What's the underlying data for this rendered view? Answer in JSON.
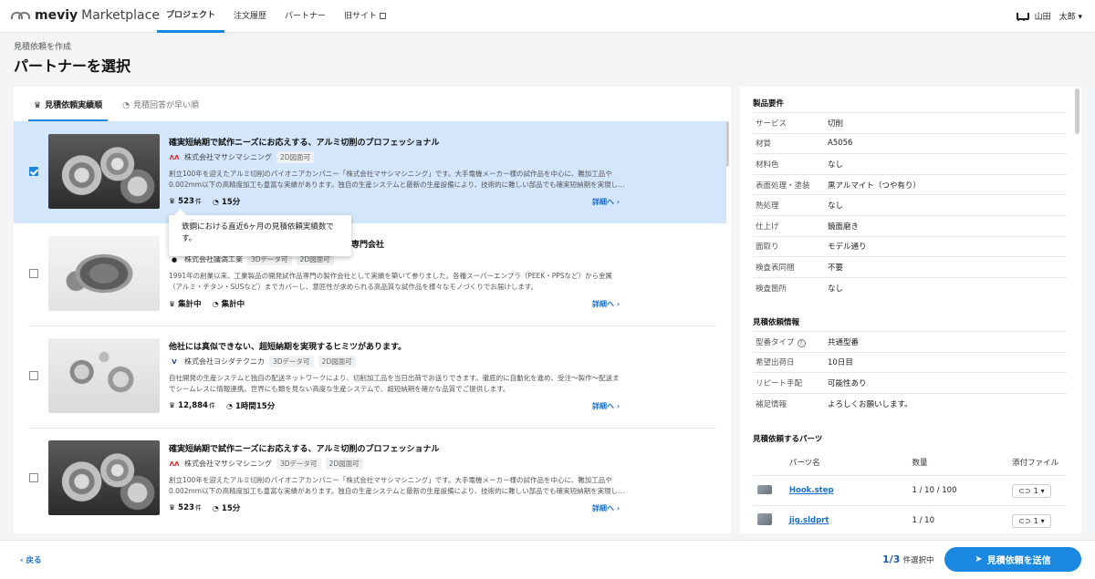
{
  "brand": {
    "logo_bold": "meviy",
    "logo_text": "Marketplace"
  },
  "nav": [
    {
      "label": "プロジェクト"
    },
    {
      "label": "注文履歴"
    },
    {
      "label": "パートナー"
    },
    {
      "label": "旧サイト"
    }
  ],
  "user": {
    "name": "山田　太郎"
  },
  "breadcrumb": "見積依頼を作成",
  "page_title": "パートナーを選択",
  "tabs": [
    {
      "label": "見積依頼実績順",
      "icon": "trophy-icon"
    },
    {
      "label": "見積回答が早い順",
      "icon": "speed-icon"
    }
  ],
  "cards": [
    {
      "selected": true,
      "title": "確実短納期で試作ニーズにお応えする、アルミ切削のプロフェッショナル",
      "company": "株式会社マサシマシニング",
      "badges": [
        "2D図面可"
      ],
      "desc": "創立100年を迎えたアルミ切削のパイオニアカンパニー「株式会社マサシマシニング」です。大手電機メーカー様の試作品を中心に、難加工品や0.002mm以下の高精度加工も豊富な実績があります。独自の生産システムと最新の生産設備により、技術的に難しい部品でも確実短納期を実現し…",
      "requests": "523",
      "requests_unit": "件",
      "lead": "15分",
      "more": "詳細へ"
    },
    {
      "selected": false,
      "title": "専門会社",
      "company": "株式会社議満工業",
      "badges": [
        "3Dデータ可",
        "2D図面可"
      ],
      "desc": "1991年の創業以来、工業製品の開発試作品専門の製作会社として実績を築いて参りました。各種スーパーエンプラ（PEEK・PPSなど）から金属（アルミ・チタン・SUSなど）までカバーし、意匠性が求められる高品質な試作品を様々なモノづくりでお届けします。",
      "requests": "集計中",
      "requests_unit": "",
      "lead": "集計中",
      "more": "詳細へ"
    },
    {
      "selected": false,
      "title": "他社には真似できない、超短納期を実現するヒミツがあります。",
      "company": "株式会社ヨシダテクニカ",
      "badges": [
        "3Dデータ可",
        "2D図面可"
      ],
      "desc": "自社開発の生産システムと独自の配送ネットワークにより、切削加工品を当日出荷でお送りできます。徹底的に自動化を進め、受注〜製作〜配送までシームレスに情報連携。世界にも類を見ない高度な生産システムで、超短納期を確かな品質でご提供します。",
      "requests": "12,884",
      "requests_unit": "件",
      "lead": "1時間15分",
      "more": "詳細へ"
    },
    {
      "selected": false,
      "title": "確実短納期で試作ニーズにお応えする、アルミ切削のプロフェッショナル",
      "company": "株式会社マサシマシニング",
      "badges": [
        "3Dデータ可",
        "2D図面可"
      ],
      "desc": "創立100年を迎えたアルミ切削のパイオニアカンパニー「株式会社マサシマシニング」です。大手電機メーカー様の試作品を中心に、難加工品や0.002mm以下の高精度加工も豊富な実績があります。独自の生産システムと最新の生産設備により、技術的に難しい部品でも確実短納期を実現し…",
      "requests": "523",
      "requests_unit": "件",
      "lead": "15分",
      "more": "詳細へ"
    }
  ],
  "tooltip": "鉄鋼における直近6ヶ月の見積依頼実績数です。",
  "product_req": {
    "heading": "製品要件",
    "rows": [
      {
        "k": "サービス",
        "v": "切削"
      },
      {
        "k": "材質",
        "v": "A5056"
      },
      {
        "k": "材料色",
        "v": "なし"
      },
      {
        "k": "表面処理・塗装",
        "v": "黒アルマイト（つや有り）"
      },
      {
        "k": "熱処理",
        "v": "なし"
      },
      {
        "k": "仕上げ",
        "v": "鏡面磨き"
      },
      {
        "k": "面取り",
        "v": "モデル通り"
      },
      {
        "k": "検査表同梱",
        "v": "不要"
      },
      {
        "k": "検査箇所",
        "v": "なし"
      }
    ]
  },
  "quote_info": {
    "heading": "見積依頼情報",
    "rows": [
      {
        "k": "型番タイプ",
        "v": "共通型番"
      },
      {
        "k": "希望出荷日",
        "v": "10日目"
      },
      {
        "k": "リピート手配",
        "v": "可能性あり"
      },
      {
        "k": "補足情報",
        "v": "よろしくお願いします。"
      }
    ]
  },
  "parts": {
    "heading": "見積依頼するパーツ",
    "cols": [
      "パーツ名",
      "数量",
      "添付ファイル"
    ],
    "rows": [
      {
        "name": "Hook.step",
        "qty": "1 / 10 / 100",
        "files": "1"
      },
      {
        "name": "jig.sldprt",
        "qty": "1 / 10",
        "files": "1"
      }
    ]
  },
  "footer": {
    "back": "戻る",
    "selected": "1",
    "total": "3",
    "selected_suffix": "件選択中",
    "submit": "見積依頼を送信"
  },
  "colors": {
    "accent": "#1a88e0",
    "selected_bg": "#d4e6fb"
  }
}
